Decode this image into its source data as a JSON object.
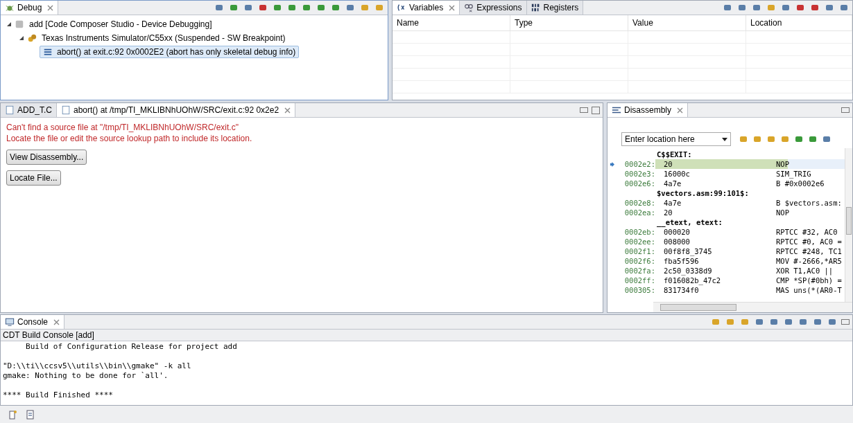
{
  "debug_view": {
    "tab": {
      "label": "Debug",
      "selected": true
    },
    "tree": [
      {
        "label": "add [Code Composer Studio - Device Debugging]",
        "kind": "launch",
        "expanded": true,
        "selected": false,
        "children": [
          {
            "label": "Texas Instruments Simulator/C55xx (Suspended - SW Breakpoint)",
            "kind": "target",
            "expanded": true,
            "selected": false,
            "children": [
              {
                "label": "abort() at exit.c:92 0x0002E2  (abort has only skeletal debug info)",
                "kind": "frame",
                "selected": true
              }
            ]
          }
        ]
      }
    ]
  },
  "variables_view": {
    "tabs": [
      {
        "label": "Variables",
        "kind": "variables",
        "selected": true
      },
      {
        "label": "Expressions",
        "kind": "expressions",
        "selected": false
      },
      {
        "label": "Registers",
        "kind": "registers",
        "selected": false
      }
    ],
    "columns": [
      "Name",
      "Type",
      "Value",
      "Location"
    ]
  },
  "editor": {
    "tabs": [
      {
        "label": "ADD_T.C",
        "selected": false
      },
      {
        "label": "abort() at /tmp/TI_MKLIBNhUOhW/SRC/exit.c:92 0x2e2",
        "selected": true
      }
    ],
    "message": [
      "Can't find a source file at \"/tmp/TI_MKLIBNhUOhW/SRC/exit.c\"",
      "Locate the file or edit the source lookup path to include its location."
    ],
    "buttons": [
      "View Disassembly...",
      "Locate File..."
    ]
  },
  "disassembly": {
    "tab": {
      "label": "Disassembly",
      "selected": true
    },
    "location": {
      "placeholder": "Enter location here"
    },
    "lines": [
      {
        "kind": "label",
        "text": "C$$EXIT:"
      },
      {
        "kind": "instr",
        "address": "0002e2:",
        "bytes": "20",
        "mnemonic": "NOP",
        "current": true
      },
      {
        "kind": "instr",
        "address": "0002e3:",
        "bytes": "16000c",
        "mnemonic": "SIM_TRIG",
        "current": false
      },
      {
        "kind": "instr",
        "address": "0002e6:",
        "bytes": "4a7e",
        "mnemonic": "B #0x0002e6",
        "current": false
      },
      {
        "kind": "label",
        "text": "$vectors.asm:99:101$:"
      },
      {
        "kind": "instr",
        "address": "0002e8:",
        "bytes": "4a7e",
        "mnemonic": "B $vectors.asm:",
        "current": false
      },
      {
        "kind": "instr",
        "address": "0002ea:",
        "bytes": "20",
        "mnemonic": "NOP",
        "current": false
      },
      {
        "kind": "label",
        "text": "__etext, etext:"
      },
      {
        "kind": "instr",
        "address": "0002eb:",
        "bytes": "000020",
        "mnemonic": "RPTCC #32, AC0",
        "current": false
      },
      {
        "kind": "instr",
        "address": "0002ee:",
        "bytes": "008000",
        "mnemonic": "RPTCC #0, AC0 =",
        "current": false
      },
      {
        "kind": "instr",
        "address": "0002f1:",
        "bytes": "00f8f8_3745",
        "mnemonic": "RPTCC #248, TC1",
        "current": false
      },
      {
        "kind": "instr",
        "address": "0002f6:",
        "bytes": "fba5f596",
        "mnemonic": "MOV #-2666,*AR5",
        "current": false
      },
      {
        "kind": "instr",
        "address": "0002fa:",
        "bytes": "2c50_0338d9",
        "mnemonic": "XOR T1,AC0 ||",
        "current": false
      },
      {
        "kind": "instr",
        "address": "0002ff:",
        "bytes": "f016082b_47c2",
        "mnemonic": "CMP *SP(#0bh) =",
        "current": false
      },
      {
        "kind": "instr",
        "address": "000305:",
        "bytes": "831734f0",
        "mnemonic": "MAS uns(*(AR0-T",
        "current": false
      }
    ]
  },
  "console": {
    "tab": {
      "label": "Console",
      "selected": true
    },
    "title": "CDT Build Console [add]",
    "paragraphs": [
      [
        "     Build of Configuration Release for project add"
      ],
      [
        "\"D:\\\\ti\\\\ccsv5\\\\utils\\\\bin\\\\gmake\" -k all",
        "gmake: Nothing to be done for `all'."
      ],
      [
        "**** Build Finished ****"
      ]
    ]
  }
}
